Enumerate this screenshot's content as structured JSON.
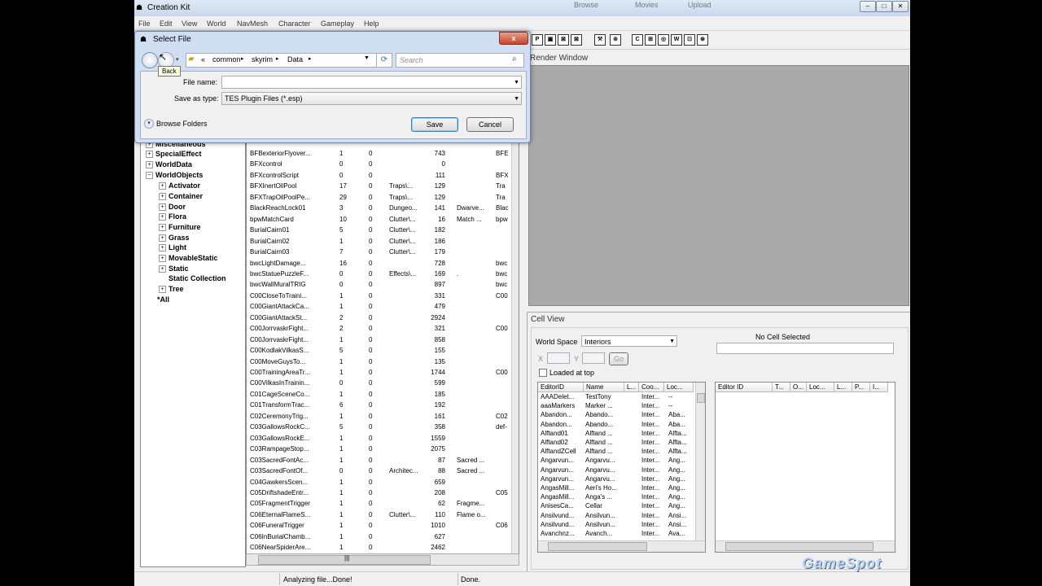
{
  "app": {
    "title": "Creation Kit",
    "menus": [
      "File",
      "Edit",
      "View",
      "World",
      "NavMesh",
      "Character",
      "Gameplay",
      "Help"
    ],
    "behind_tabs": [
      "Browse",
      "Movies",
      "Upload"
    ],
    "toolbar_glyphs": [
      "P",
      "▣",
      "⊠",
      "⊠",
      "⚒",
      "⊚",
      "C",
      "⊞",
      "◎",
      "W",
      "⊡",
      "⊛"
    ]
  },
  "dialog": {
    "title": "Select File",
    "back_tooltip": "Back",
    "breadcrumb": [
      "«",
      "common",
      "skyrim",
      "Data"
    ],
    "search_placeholder": "Search",
    "file_name_label": "File name:",
    "file_name_value": "",
    "save_type_label": "Save as type:",
    "save_type_value": "TES Plugin Files (*.esp)",
    "browse_folders": "Browse Folders",
    "save_button": "Save",
    "cancel_button": "Cancel",
    "close_glyph": "x"
  },
  "tree": {
    "partial_top": "Miscellaneous",
    "top_items": [
      "SpecialEffect",
      "WorldData",
      "WorldObjects"
    ],
    "children": [
      "Activator",
      "Container",
      "Door",
      "Flora",
      "Furniture",
      "Grass",
      "Light",
      "MovableStatic",
      "Static",
      "Static Collection",
      "Tree"
    ],
    "all_item": "*All"
  },
  "objects": [
    [
      "BFBexteriorFlyover...",
      "1",
      "0",
      "",
      "743",
      "",
      "BFE"
    ],
    [
      "BFXcontrol",
      "0",
      "0",
      "",
      "0",
      "",
      ""
    ],
    [
      "BFXcontrolScript",
      "0",
      "0",
      "",
      "111",
      "",
      "BFX"
    ],
    [
      "BFXInertOilPool",
      "17",
      "0",
      "Traps\\...",
      "129",
      "",
      "Tra"
    ],
    [
      "BFXTrapOilPoolPe...",
      "29",
      "0",
      "Traps\\...",
      "129",
      "",
      "Tra"
    ],
    [
      "BlackReachLock01",
      "3",
      "0",
      "Dungeo...",
      "141",
      "Dwarve...",
      "Blac"
    ],
    [
      "bpwMatchCard",
      "10",
      "0",
      "Clutter\\...",
      "16",
      "Match ...",
      "bpw"
    ],
    [
      "BurialCairn01",
      "5",
      "0",
      "Clutter\\...",
      "182",
      "",
      ""
    ],
    [
      "BurialCairn02",
      "1",
      "0",
      "Clutter\\...",
      "186",
      "",
      ""
    ],
    [
      "BurialCairn03",
      "7",
      "0",
      "Clutter\\...",
      "179",
      "",
      ""
    ],
    [
      "bwcLightDamage...",
      "16",
      "0",
      "",
      "728",
      "",
      "bwc"
    ],
    [
      "bwcStatuePuzzleF...",
      "0",
      "0",
      "Effects\\...",
      "169",
      ".",
      "bwc"
    ],
    [
      "bwcWallMuralTRIG",
      "0",
      "0",
      "",
      "897",
      "",
      "bwc"
    ],
    [
      "C00CloseToTraini...",
      "1",
      "0",
      "",
      "331",
      "",
      "C00"
    ],
    [
      "C00GiantAttackCa...",
      "1",
      "0",
      "",
      "479",
      "",
      ""
    ],
    [
      "C00GiantAttackSt...",
      "2",
      "0",
      "",
      "2924",
      "",
      ""
    ],
    [
      "C00JorrvaskrFight...",
      "2",
      "0",
      "",
      "321",
      "",
      "C00"
    ],
    [
      "C00JorrvaskrFight...",
      "1",
      "0",
      "",
      "858",
      "",
      ""
    ],
    [
      "C00KodlakVilkasS...",
      "5",
      "0",
      "",
      "155",
      "",
      ""
    ],
    [
      "C00MoveGuysTo...",
      "1",
      "0",
      "",
      "135",
      "",
      ""
    ],
    [
      "C00TrainingAreaTr...",
      "1",
      "0",
      "",
      "1744",
      "",
      "C00"
    ],
    [
      "C00VilkasInTrainin...",
      "0",
      "0",
      "",
      "599",
      "",
      ""
    ],
    [
      "C01CageSceneCo...",
      "1",
      "0",
      "",
      "185",
      "",
      ""
    ],
    [
      "C01TransformTrac...",
      "6",
      "0",
      "",
      "192",
      "",
      ""
    ],
    [
      "C02CeremonyTrig...",
      "1",
      "0",
      "",
      "161",
      "",
      "C02"
    ],
    [
      "C03GallowsRockC...",
      "5",
      "0",
      "",
      "358",
      "",
      "def-"
    ],
    [
      "C03GallowsRockE...",
      "1",
      "0",
      "",
      "1559",
      "",
      ""
    ],
    [
      "C03RampageStop...",
      "1",
      "0",
      "",
      "2075",
      "",
      ""
    ],
    [
      "C03SacredFontAc...",
      "1",
      "0",
      "",
      "87",
      "Sacred ...",
      ""
    ],
    [
      "C03SacredFontOf...",
      "0",
      "0",
      "Architec...",
      "88",
      "Sacred ...",
      ""
    ],
    [
      "C04GawkersScen...",
      "1",
      "0",
      "",
      "659",
      "",
      ""
    ],
    [
      "C05DriftshadeEntr...",
      "1",
      "0",
      "",
      "208",
      "",
      "C05"
    ],
    [
      "C05FragmentTrigger",
      "1",
      "0",
      "",
      "62",
      "Fragme...",
      ""
    ],
    [
      "C06EternalFlameS...",
      "1",
      "0",
      "Clutter\\...",
      "110",
      "Flame o...",
      ""
    ],
    [
      "C06FuneralTrigger",
      "1",
      "0",
      "",
      "1010",
      "",
      "C06"
    ],
    [
      "C06InBurialChamb...",
      "1",
      "0",
      "",
      "627",
      "",
      ""
    ],
    [
      "C06NearSpiderAre...",
      "1",
      "0",
      "",
      "2462",
      "",
      ""
    ]
  ],
  "render": {
    "title": "Render Window"
  },
  "cellview": {
    "title": "Cell View",
    "worldspace_label": "World Space",
    "worldspace_value": "Interiors",
    "x_label": "X",
    "y_label": "Y",
    "go_button": "Go",
    "loaded_at_top": "Loaded at top",
    "no_cell": "No Cell Selected",
    "left_headers": [
      "EditorID",
      "Name",
      "L...",
      "Coo...",
      "Loc..."
    ],
    "right_headers": [
      "Editor ID",
      "T...",
      "O...",
      "Loc...",
      "L...",
      "P...",
      "I..."
    ],
    "rows": [
      [
        "AAADelet...",
        "TestTony",
        "",
        "Inter...",
        "--"
      ],
      [
        "aaaMarkers",
        "Marker ...",
        "",
        "Inter...",
        "--"
      ],
      [
        "Abandon...",
        "Abando...",
        "",
        "Inter...",
        "Aba..."
      ],
      [
        "Abandon...",
        "Abando...",
        "",
        "Inter...",
        "Aba..."
      ],
      [
        "Alftand01",
        "Alftand ...",
        "",
        "Inter...",
        "Alfta..."
      ],
      [
        "Alftand02",
        "Alftand ...",
        "",
        "Inter...",
        "Alfta..."
      ],
      [
        "AlftandZCell",
        "Alftand ...",
        "",
        "Inter...",
        "Alfta..."
      ],
      [
        "Angarvun...",
        "Angarvu...",
        "",
        "Inter...",
        "Ang..."
      ],
      [
        "Angarvun...",
        "Angarvu...",
        "",
        "Inter...",
        "Ang..."
      ],
      [
        "Angarvun...",
        "Angarvu...",
        "",
        "Inter...",
        "Ang..."
      ],
      [
        "AngasMill...",
        "Aeri's Ho...",
        "",
        "Inter...",
        "Ang..."
      ],
      [
        "AngasMill...",
        "Anga's ...",
        "",
        "Inter...",
        "Ang..."
      ],
      [
        "AnisesCa...",
        "Cellar",
        "",
        "Inter...",
        "Ang..."
      ],
      [
        "Ansilvund...",
        "Ansilvun...",
        "",
        "Inter...",
        "Ansi..."
      ],
      [
        "Ansilvund...",
        "Ansilvun...",
        "",
        "Inter...",
        "Ansi..."
      ],
      [
        "Avanchnz...",
        "Avanch...",
        "",
        "Inter...",
        "Ava..."
      ]
    ]
  },
  "status": {
    "left": "Analyzing file...Done!",
    "right": "Done."
  },
  "watermark": "GameSpot"
}
